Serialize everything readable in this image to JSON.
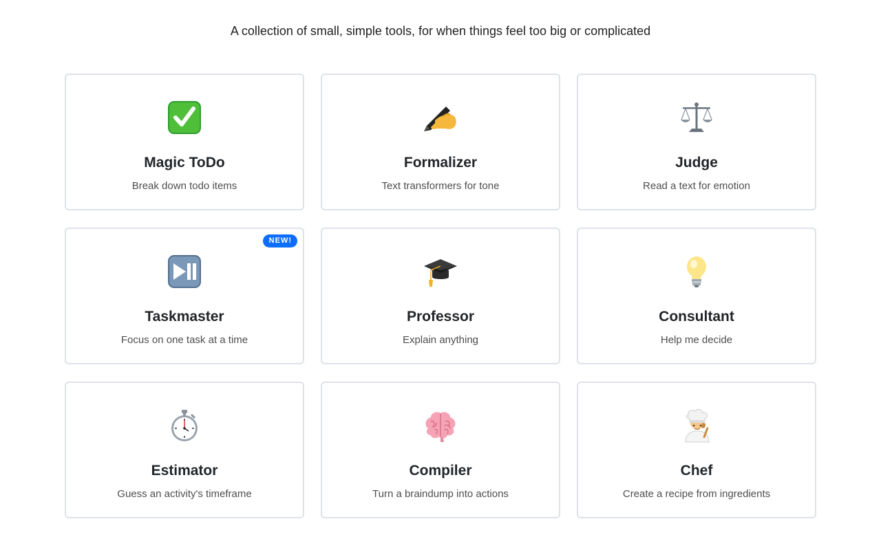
{
  "header": {
    "tagline": "A collection of small, simple tools, for when things feel too big or complicated"
  },
  "tools": [
    {
      "title": "Magic ToDo",
      "description": "Break down todo items",
      "icon": "check-mark-button-icon"
    },
    {
      "title": "Formalizer",
      "description": "Text transformers for tone",
      "icon": "writing-hand-icon"
    },
    {
      "title": "Judge",
      "description": "Read a text for emotion",
      "icon": "balance-scale-icon"
    },
    {
      "title": "Taskmaster",
      "description": "Focus on one task at a time",
      "icon": "play-pause-button-icon",
      "badge": "NEW!"
    },
    {
      "title": "Professor",
      "description": "Explain anything",
      "icon": "graduation-cap-icon"
    },
    {
      "title": "Consultant",
      "description": "Help me decide",
      "icon": "light-bulb-icon"
    },
    {
      "title": "Estimator",
      "description": "Guess an activity's timeframe",
      "icon": "stopwatch-icon"
    },
    {
      "title": "Compiler",
      "description": "Turn a braindump into actions",
      "icon": "brain-icon"
    },
    {
      "title": "Chef",
      "description": "Create a recipe from ingredients",
      "icon": "cook-icon"
    }
  ],
  "colors": {
    "badge": "#0d6efd",
    "card_border": "#dee2e6"
  }
}
